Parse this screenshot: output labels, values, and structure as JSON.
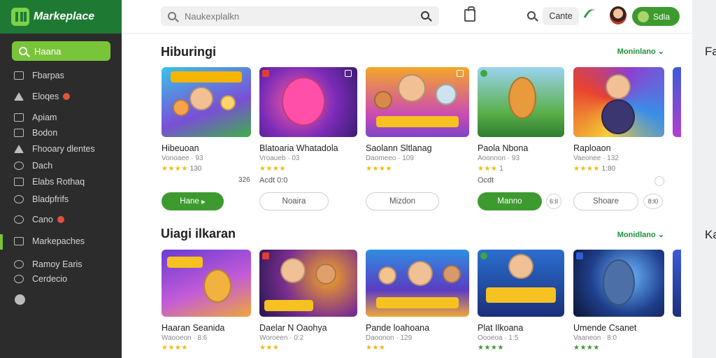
{
  "brand": {
    "name": "Markeplace"
  },
  "sidebar": {
    "search_label": "Haana",
    "items": [
      {
        "label": "Fbarpas",
        "icon": "thumbs-icon"
      },
      {
        "label": "Eloqes",
        "icon": "tag-icon",
        "badge": true
      },
      {
        "label": "Apiam",
        "icon": "grid-icon"
      },
      {
        "label": "Bodon",
        "icon": "image-icon"
      },
      {
        "label": "Fhooary dlentes",
        "icon": "home-icon"
      },
      {
        "label": "Dach",
        "icon": "chat-icon"
      },
      {
        "label": "Elabs Rothaq",
        "icon": "list-icon"
      },
      {
        "label": "Bladpfrifs",
        "icon": "puzzle-icon"
      },
      {
        "label": "Cano",
        "icon": "chat-icon",
        "badge": true
      },
      {
        "label": "Markepaches",
        "icon": "store-icon",
        "active": true
      },
      {
        "label": "Ramoy Earis",
        "icon": "link-icon"
      },
      {
        "label": "Cerdecio",
        "icon": "bookmark-icon"
      }
    ]
  },
  "topbar": {
    "search_text": "Naukexplalkn",
    "cart_label": "Cante",
    "user_label": "Sdla"
  },
  "sections": [
    {
      "title": "Hiburingi",
      "see_all": "Moninlano",
      "cards": [
        {
          "title": "Hibeuoan",
          "subtitle": "Vonoaee · 93",
          "stars": "★★★★",
          "rating": "130",
          "extra": "",
          "button": "Hane",
          "button_style": "green"
        },
        {
          "title": "Blatoaria Whatadola",
          "subtitle": "Vroaueb · 03",
          "stars": "★★★★",
          "rating": "",
          "extra": "Acdt 0:0",
          "button": "Noaira",
          "button_style": "outline"
        },
        {
          "title": "Saolann Sltlanag",
          "subtitle": "Daomeeo · 109",
          "stars": "★★★★",
          "rating": "",
          "extra": "",
          "button": "Mizdon",
          "button_style": "outline"
        },
        {
          "title": "Paola Nbona",
          "subtitle": "Aoonnon · 93",
          "stars": "★★★",
          "rating": "1",
          "extra": "Ocdt",
          "button": "Manno",
          "button_style": "green",
          "side": "6:Il"
        },
        {
          "title": "Raploaon",
          "subtitle": "Vaeonee · 132",
          "stars": "★★★★",
          "rating": "1:80",
          "extra": "",
          "button": "Shoare",
          "button_style": "outline",
          "side": "8:l0"
        }
      ]
    },
    {
      "title": "Uiagi ilkaran",
      "see_all": "Monidlano",
      "cards": [
        {
          "title": "Haaran Seanida",
          "subtitle": "Waooeon · 8:6",
          "stars": "★★★★",
          "rating": ""
        },
        {
          "title": "Daelar N Oaohya",
          "subtitle": "Woroeen · 0:2",
          "stars": "★★★",
          "rating": ""
        },
        {
          "title": "Pande loahoana",
          "subtitle": "Daoonon · 129",
          "stars": "★★★",
          "rating": ""
        },
        {
          "title": "Plat Ilkoana",
          "subtitle": "Oooeoa · 1:5",
          "stars": "★★★★",
          "rating": ""
        },
        {
          "title": "Umende Csanet",
          "subtitle": "Vaaneon · 8:0",
          "stars": "★★★★",
          "rating": ""
        }
      ]
    }
  ],
  "right_panel": {
    "top_text": "Fa",
    "bottom_text": "Ka"
  },
  "colors": {
    "brand_green": "#1e7a33",
    "accent_green": "#79c53a",
    "button_green": "#3d9a2f",
    "sidebar_bg": "#2c2c2c"
  }
}
